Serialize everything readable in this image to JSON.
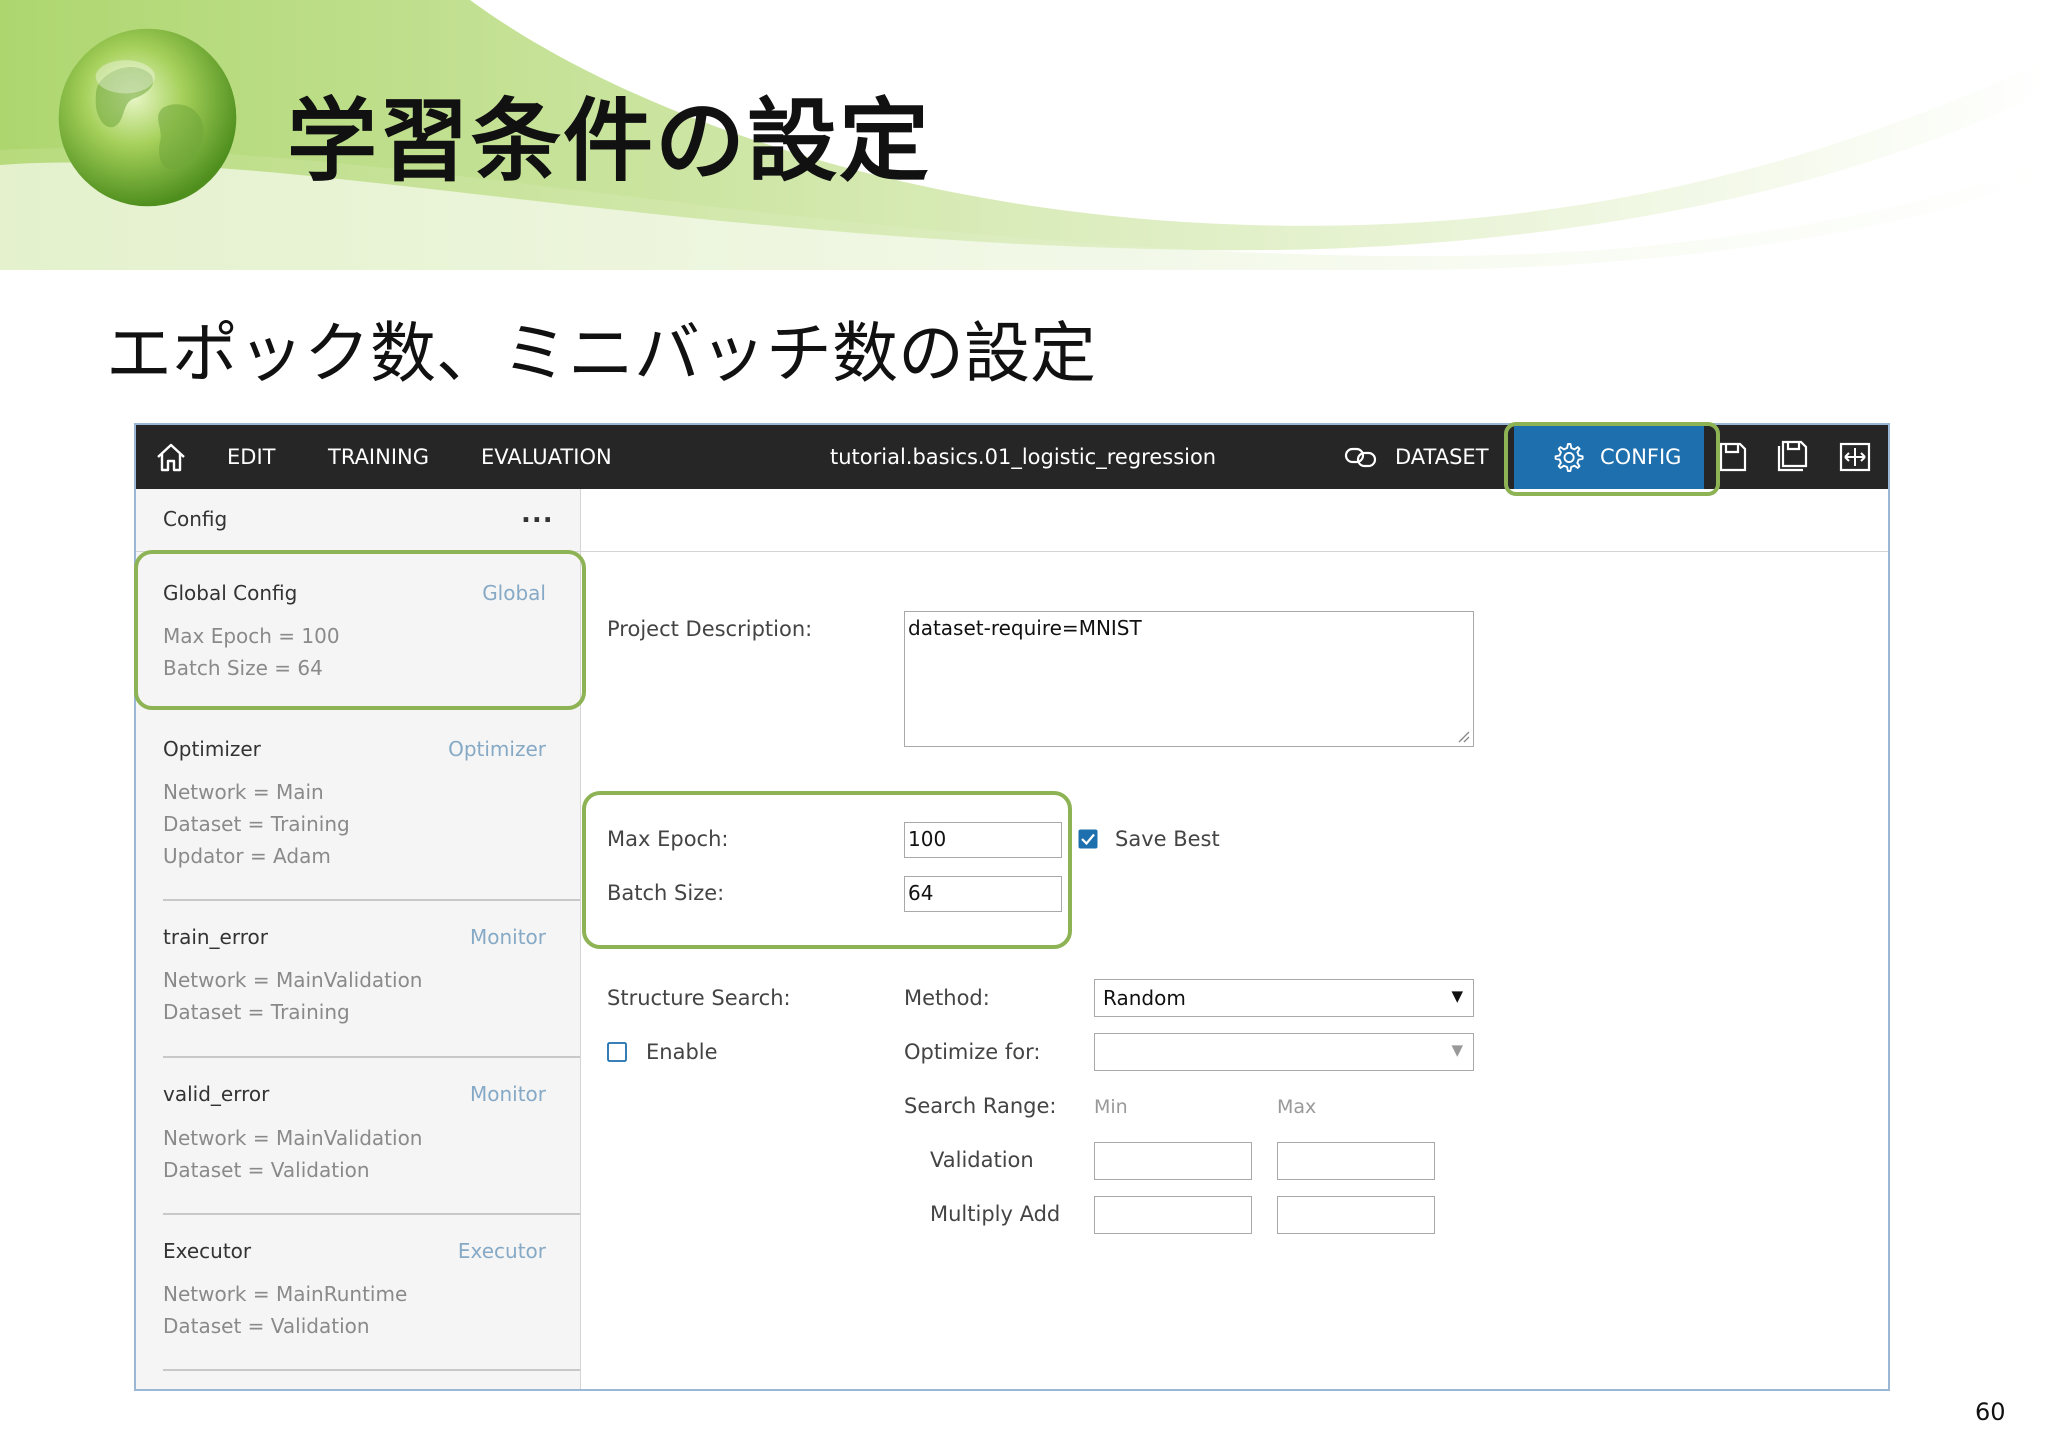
{
  "slide": {
    "title": "学習条件の設定",
    "subtitle": "エポック数、ミニバッチ数の設定",
    "page_number": "60"
  },
  "toolbar": {
    "edit": "EDIT",
    "training": "TRAINING",
    "evaluation": "EVALUATION",
    "project_name": "tutorial.basics.01_logistic_regression",
    "dataset": "DATASET",
    "config": "CONFIG"
  },
  "sidebar": {
    "header": "Config",
    "more": "...",
    "items": [
      {
        "title": "Global Config",
        "type": "Global",
        "lines": [
          "Max Epoch = 100",
          "Batch Size = 64"
        ]
      },
      {
        "title": "Optimizer",
        "type": "Optimizer",
        "lines": [
          "Network = Main",
          "Dataset = Training",
          "Updator = Adam"
        ]
      },
      {
        "title": "train_error",
        "type": "Monitor",
        "lines": [
          "Network = MainValidation",
          "Dataset = Training"
        ]
      },
      {
        "title": "valid_error",
        "type": "Monitor",
        "lines": [
          "Network = MainValidation",
          "Dataset = Validation"
        ]
      },
      {
        "title": "Executor",
        "type": "Executor",
        "lines": [
          "Network = MainRuntime",
          "Dataset = Validation"
        ]
      }
    ]
  },
  "form": {
    "project_description_label": "Project Description:",
    "project_description_value": "dataset-require=MNIST",
    "max_epoch_label": "Max Epoch:",
    "max_epoch_value": "100",
    "batch_size_label": "Batch Size:",
    "batch_size_value": "64",
    "save_best_label": "Save Best",
    "save_best_checked": true,
    "structure_search_label": "Structure Search:",
    "enable_label": "Enable",
    "enable_checked": false,
    "method_label": "Method:",
    "method_value": "Random",
    "optimize_for_label": "Optimize for:",
    "optimize_for_value": "",
    "search_range_label": "Search Range:",
    "min_label": "Min",
    "max_label": "Max",
    "validation_label": "Validation",
    "multiply_add_label": "Multiply Add",
    "validation_min": "",
    "validation_max": "",
    "multiply_add_min": "",
    "multiply_add_max": ""
  },
  "colors": {
    "toolbar_bg": "#262626",
    "config_tab_bg": "#1e6fad",
    "highlight_border": "#8db355",
    "checkbox_checked": "#1e6fad"
  }
}
